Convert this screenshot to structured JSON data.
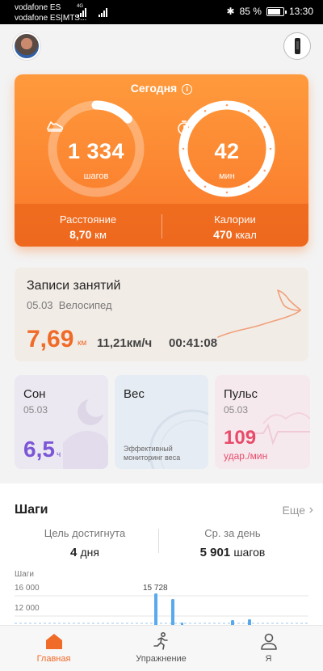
{
  "status_bar": {
    "carrier1": "vodafone ES",
    "carrier2": "vodafone ES|MTS...",
    "network": "4G",
    "battery": "85 %",
    "battery_level": 0.85,
    "time": "13:30"
  },
  "today": {
    "title": "Сегодня",
    "info_icon": "i",
    "steps_value": "1 334",
    "steps_unit": "шагов",
    "steps_progress": 0.13,
    "minutes_value": "42",
    "minutes_unit": "мин",
    "distance_label": "Расстояние",
    "distance_value": "8,70",
    "distance_unit": "км",
    "calories_label": "Калории",
    "calories_value": "470",
    "calories_unit": "ккал"
  },
  "activity": {
    "title": "Записи занятий",
    "date": "05.03",
    "type": "Велосипед",
    "distance": "7,69",
    "distance_unit": "км",
    "speed": "11,21км/ч",
    "duration": "00:41:08"
  },
  "cards": {
    "sleep": {
      "title": "Сон",
      "date": "05.03",
      "value": "6,5",
      "unit": "ч"
    },
    "weight": {
      "title": "Вес",
      "note": "Эффективный мониторинг веса"
    },
    "pulse": {
      "title": "Пульс",
      "date": "05.03",
      "value": "109",
      "unit": "удар./мин"
    }
  },
  "steps_section": {
    "title": "Шаги",
    "more": "Еще",
    "goal_label": "Цель достигнута",
    "goal_value": "4",
    "goal_unit": "дня",
    "avg_label": "Ср. за день",
    "avg_value": "5 901",
    "avg_unit": "шагов",
    "chart_ylabel": "Шаги",
    "tick_1": "16 000",
    "tick_2": "12 000",
    "peak_label": "15 728"
  },
  "nav": {
    "home": "Главная",
    "exercise": "Упражнение",
    "me": "Я"
  },
  "colors": {
    "accent": "#f06a28",
    "card_orange": "#f9772a",
    "sleep": "#7b56d6",
    "pulse": "#e84b6a",
    "chart_bar": "#5aa9ec"
  }
}
